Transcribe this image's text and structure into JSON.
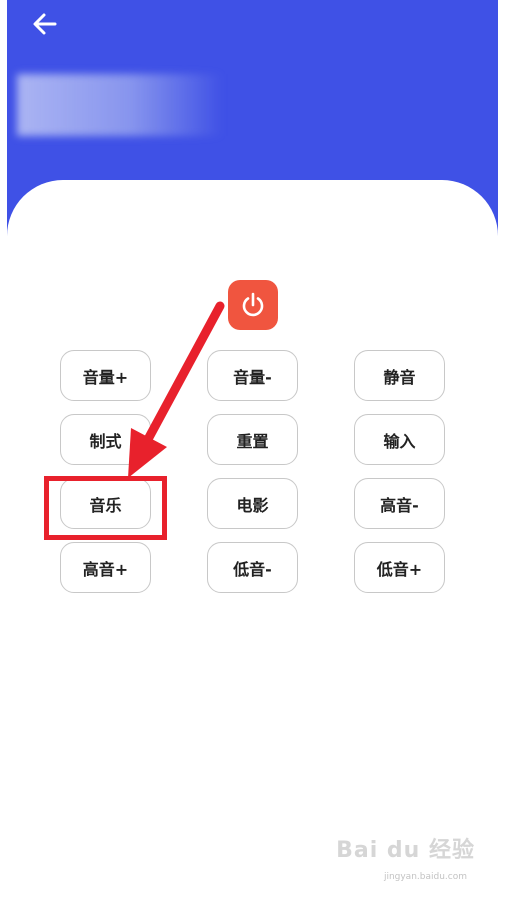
{
  "header": {
    "back_icon": "arrow-left-icon",
    "title_blurred": true,
    "color": "#3f51e6"
  },
  "remote": {
    "power_icon": "power-icon",
    "power_color": "#f0553f",
    "buttons": [
      {
        "label": "音量+"
      },
      {
        "label": "音量-"
      },
      {
        "label": "静音"
      },
      {
        "label": "制式"
      },
      {
        "label": "重置"
      },
      {
        "label": "输入"
      },
      {
        "label": "音乐"
      },
      {
        "label": "电影"
      },
      {
        "label": "高音-"
      },
      {
        "label": "高音+"
      },
      {
        "label": "低音-"
      },
      {
        "label": "低音+"
      }
    ]
  },
  "annotation": {
    "highlighted_button": "音乐",
    "color": "#e8212c"
  },
  "watermark": {
    "text": "Bai du 经验",
    "url": "jingyan.baidu.com"
  }
}
